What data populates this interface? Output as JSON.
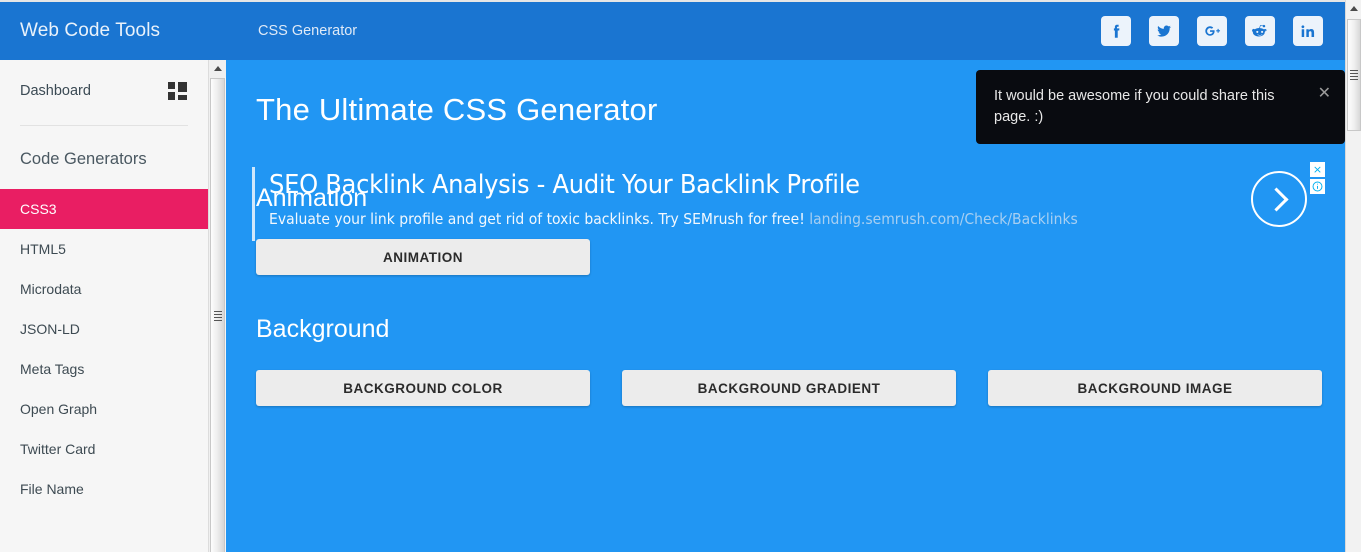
{
  "header": {
    "brand": "Web Code Tools",
    "page_tag": "CSS Generator",
    "social": [
      {
        "name": "facebook-icon",
        "label": "f"
      },
      {
        "name": "twitter-icon",
        "label": "t"
      },
      {
        "name": "google-plus-icon",
        "label": "G+"
      },
      {
        "name": "reddit-icon",
        "label": "r"
      },
      {
        "name": "linkedin-icon",
        "label": "in"
      }
    ],
    "bg_color": "#1a75d1"
  },
  "sidebar": {
    "dashboard_label": "Dashboard",
    "dashboard_icon": "grid-dashboard-icon",
    "group_heading": "Code Generators",
    "active_color": "#e91e63",
    "items": [
      {
        "label": "CSS3",
        "active": true
      },
      {
        "label": "HTML5",
        "active": false
      },
      {
        "label": "Microdata",
        "active": false
      },
      {
        "label": "JSON-LD",
        "active": false
      },
      {
        "label": "Meta Tags",
        "active": false
      },
      {
        "label": "Open Graph",
        "active": false
      },
      {
        "label": "Twitter Card",
        "active": false
      },
      {
        "label": "File Name",
        "active": false
      }
    ]
  },
  "main": {
    "title": "The Ultimate CSS Generator",
    "bg_color": "#2196f3",
    "sections": [
      {
        "heading": "Animation",
        "buttons": [
          "ANIMATION"
        ]
      },
      {
        "heading": "Background",
        "buttons": [
          "BACKGROUND COLOR",
          "BACKGROUND GRADIENT",
          "BACKGROUND IMAGE"
        ]
      }
    ]
  },
  "ad": {
    "title": "SEO Backlink Analysis - Audit Your Backlink Profile",
    "description": "Evaluate your link profile and get rid of toxic backlinks. Try SEMrush for free!",
    "url": "landing.semrush.com/Check/Backlinks",
    "arrow_icon": "chevron-right-icon",
    "close_icon": "×",
    "info_icon": "i"
  },
  "toast": {
    "message": "It would be awesome if you could share this page. :)",
    "close_label": "✕",
    "bg_color": "#090b10"
  }
}
